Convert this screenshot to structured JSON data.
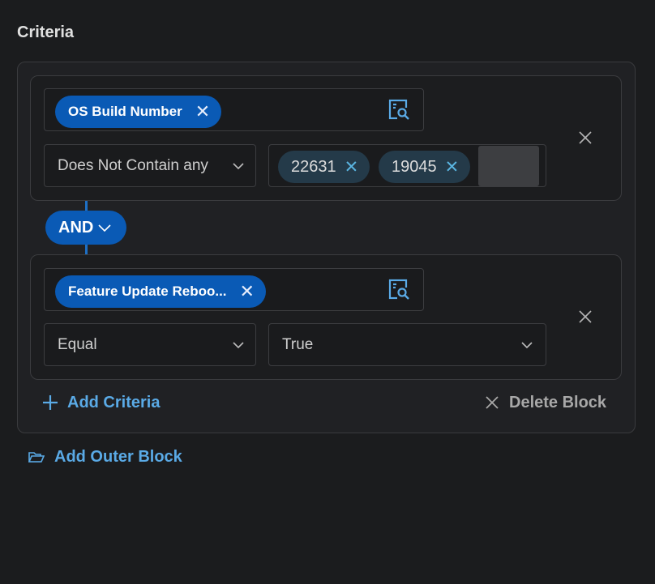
{
  "section_title": "Criteria",
  "block1": {
    "field_label": "OS Build Number",
    "operator": "Does Not Contain any",
    "values": [
      "22631",
      "19045"
    ]
  },
  "logic": {
    "operator": "AND"
  },
  "block2": {
    "field_label": "Feature Update Reboo...",
    "operator": "Equal",
    "value": "True"
  },
  "actions": {
    "add_criteria": "Add Criteria",
    "delete_block": "Delete Block",
    "add_outer_block": "Add Outer Block"
  },
  "colors": {
    "accent": "#0a5ab5",
    "link": "#5aaae6",
    "background": "#1b1c1e"
  },
  "icons": {
    "lookup": "search-list-icon",
    "remove": "close-icon",
    "dropdown": "chevron-down-icon",
    "add": "plus-icon",
    "outer_block": "folder-icon"
  }
}
